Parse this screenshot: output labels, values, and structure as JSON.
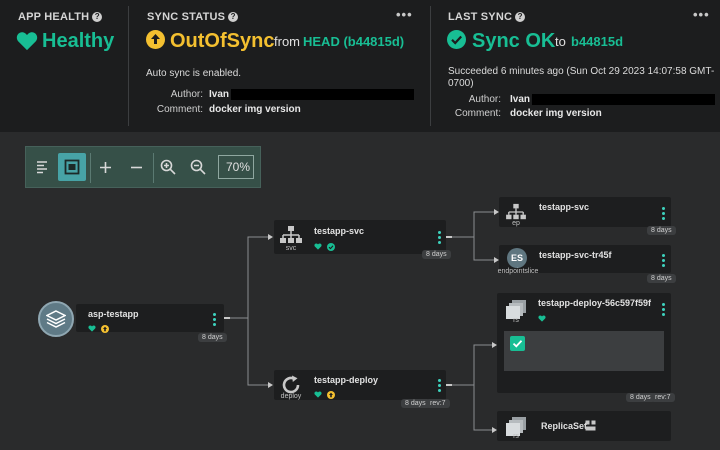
{
  "header": {
    "app_health": {
      "title": "APP HEALTH",
      "help": "?",
      "status": "Healthy",
      "status_color": "#18be94",
      "icon": "heart-icon"
    },
    "sync_status": {
      "title": "SYNC STATUS",
      "help": "?",
      "status": "OutOfSync",
      "status_color": "#f4c030",
      "icon": "arrow-up-circle-icon",
      "from_prefix": "from",
      "revision": "HEAD (b44815d)",
      "auto_sync": "Auto sync is enabled.",
      "author_label": "Author:",
      "author": "Ivan",
      "comment_label": "Comment:",
      "comment": "docker img version",
      "menu": "•••"
    },
    "last_sync": {
      "title": "LAST SYNC",
      "help": "?",
      "status": "Sync OK",
      "status_color": "#18be94",
      "icon": "check-circle-icon",
      "to_prefix": "to",
      "revision": "b44815d",
      "succeeded_line1": "Succeeded 6 minutes ago (Sun Oct 29 2023 14:07:58 GMT-",
      "succeeded_line2": "0700)",
      "author_label": "Author:",
      "author": "Ivan",
      "comment_label": "Comment:",
      "comment": "docker img version",
      "menu": "•••"
    }
  },
  "toolbar": {
    "buttons": [
      "list-view-icon",
      "fit-to-screen-icon",
      "expand-plus-icon",
      "collapse-minus-icon",
      "zoom-in-icon",
      "zoom-out-icon"
    ],
    "zoom": "70%"
  },
  "graph": {
    "app": {
      "name": "asp-testapp",
      "age": "8 days",
      "icon": "layers-icon"
    },
    "svc": {
      "name": "testapp-svc",
      "kind": "svc",
      "age": "8 days",
      "icon": "network-icon"
    },
    "deploy": {
      "name": "testapp-deploy",
      "kind": "deploy",
      "age": "8 days",
      "rev": "rev:7",
      "icon": "sync-icon"
    },
    "ep": {
      "name": "testapp-svc",
      "kind": "ep",
      "age": "8 days",
      "icon": "network-icon"
    },
    "es": {
      "name": "testapp-svc-tr45f",
      "kind": "endpointslice",
      "abbr": "ES",
      "age": "8 days"
    },
    "rs": {
      "name": "testapp-deploy-56c597f59f",
      "kind": "rs",
      "age": "8 days",
      "rev": "rev:7",
      "icon": "replicaset-icon"
    },
    "rs_group": {
      "name": "ReplicaSet",
      "kind": "rs",
      "icon": "replicaset-icon"
    }
  }
}
